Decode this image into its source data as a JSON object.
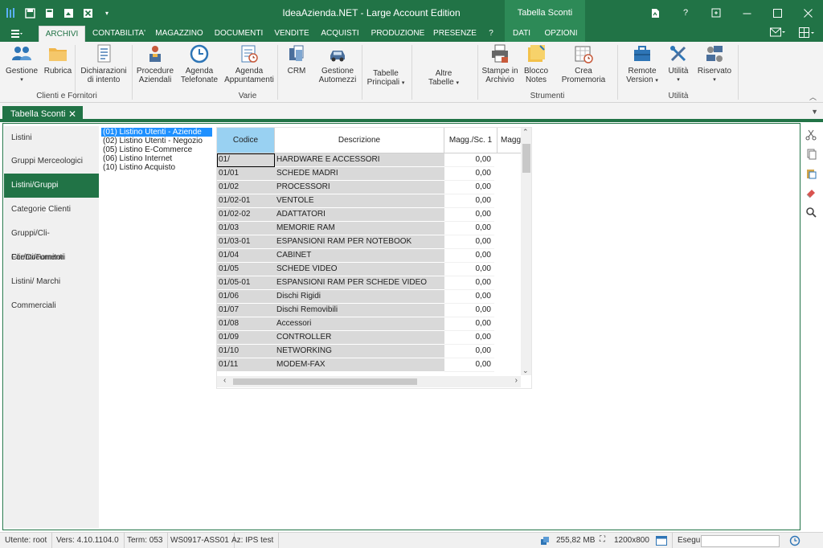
{
  "window": {
    "title": "IdeaAzienda.NET - Large Account Edition",
    "context_tab_title": "Tabella Sconti",
    "controls": [
      "help",
      "question",
      "restore",
      "minimize",
      "maximize",
      "close"
    ]
  },
  "ribbon_tabs": [
    {
      "label": "ARCHIVI",
      "active": true
    },
    {
      "label": "CONTABILITA'"
    },
    {
      "label": "MAGAZZINO"
    },
    {
      "label": "DOCUMENTI"
    },
    {
      "label": "VENDITE"
    },
    {
      "label": "ACQUISTI"
    },
    {
      "label": "PRODUZIONE"
    },
    {
      "label": "PRESENZE"
    },
    {
      "label": "?"
    },
    {
      "label": "DATI"
    },
    {
      "label": "OPZIONI"
    }
  ],
  "ribbon": {
    "buttons": [
      {
        "label1": "Gestione",
        "label2": "",
        "dropdown": true,
        "icon": "users-icon"
      },
      {
        "label1": "Rubrica",
        "label2": "",
        "icon": "folder-icon"
      },
      {
        "label1": "Dichiarazioni",
        "label2": "di intento",
        "icon": "document-icon"
      },
      {
        "label1": "Procedure",
        "label2": "Aziendali",
        "icon": "procedure-icon"
      },
      {
        "label1": "Agenda",
        "label2": "Telefonate",
        "icon": "clock-icon"
      },
      {
        "label1": "Agenda",
        "label2": "Appuntamenti",
        "icon": "calendar-icon"
      },
      {
        "label1": "CRM",
        "label2": "",
        "icon": "crm-icon"
      },
      {
        "label1": "Gestione",
        "label2": "Automezzi",
        "icon": "car-icon"
      },
      {
        "label1": "Tabelle",
        "label2": "Principali",
        "dropdown_inline": true
      },
      {
        "label1": "Altre",
        "label2": "Tabelle",
        "dropdown_inline": true
      },
      {
        "label1": "Stampe in",
        "label2": "Archivio",
        "icon": "printer-icon"
      },
      {
        "label1": "Blocco",
        "label2": "Notes",
        "icon": "notes-icon"
      },
      {
        "label1": "Crea Promemoria",
        "label2": "",
        "icon": "reminder-icon"
      },
      {
        "label1": "Remote",
        "label2": "Version",
        "dropdown_inline": true,
        "icon": "briefcase-icon"
      },
      {
        "label1": "Utilità",
        "label2": "",
        "dropdown": true,
        "icon": "tools-icon"
      },
      {
        "label1": "Riservato",
        "label2": "",
        "dropdown": true,
        "icon": "gears-icon"
      }
    ],
    "groups": [
      "Clienti e Fornitori",
      "Varie",
      "Strumenti",
      "Utilità"
    ]
  },
  "document_tab": {
    "label": "Tabella Sconti",
    "close": "✕"
  },
  "left_nav": [
    {
      "label": "Listini"
    },
    {
      "label": "Gruppi Merceologici"
    },
    {
      "label": "Listini/Gruppi Merceologici",
      "active": true
    },
    {
      "label": "Categorie Clienti"
    },
    {
      "label": "Gruppi/Cli-For/Documenti"
    },
    {
      "label": "Clienti/Fornitori"
    },
    {
      "label": "Listini/ Marchi Commerciali"
    }
  ],
  "price_lists": [
    {
      "label": "(01) Listino Utenti - Aziende",
      "selected": true
    },
    {
      "label": "(02) Listino Utenti - Negozio"
    },
    {
      "label": "(05) Listino E-Commerce"
    },
    {
      "label": "(06) Listino Internet"
    },
    {
      "label": "(10) Listino Acquisto"
    }
  ],
  "grid": {
    "headers": [
      "Codice",
      "Descrizione",
      "Magg./Sc. 1",
      "Magg"
    ],
    "rows": [
      {
        "code": "01/",
        "desc": "HARDWARE E ACCESSORI",
        "value": "0,00"
      },
      {
        "code": "01/01",
        "desc": "SCHEDE MADRI",
        "value": "0,00"
      },
      {
        "code": "01/02",
        "desc": "PROCESSORI",
        "value": "0,00"
      },
      {
        "code": "01/02-01",
        "desc": "VENTOLE",
        "value": "0,00"
      },
      {
        "code": "01/02-02",
        "desc": "ADATTATORI",
        "value": "0,00"
      },
      {
        "code": "01/03",
        "desc": "MEMORIE RAM",
        "value": "0,00"
      },
      {
        "code": "01/03-01",
        "desc": "ESPANSIONI RAM PER NOTEBOOK",
        "value": "0,00"
      },
      {
        "code": "01/04",
        "desc": "CABINET",
        "value": "0,00"
      },
      {
        "code": "01/05",
        "desc": "SCHEDE VIDEO",
        "value": "0,00"
      },
      {
        "code": "01/05-01",
        "desc": "ESPANSIONI RAM PER SCHEDE VIDEO",
        "value": "0,00"
      },
      {
        "code": "01/06",
        "desc": "Dischi Rigidi",
        "value": "0,00"
      },
      {
        "code": "01/07",
        "desc": "Dischi Removibili",
        "value": "0,00"
      },
      {
        "code": "01/08",
        "desc": "Accessori",
        "value": "0,00"
      },
      {
        "code": "01/09",
        "desc": "CONTROLLER",
        "value": "0,00"
      },
      {
        "code": "01/10",
        "desc": "NETWORKING",
        "value": "0,00"
      },
      {
        "code": "01/11",
        "desc": "MODEM-FAX",
        "value": "0,00"
      }
    ]
  },
  "right_tools": [
    "scissors-icon",
    "copy-icon",
    "paste-icon",
    "eraser-icon",
    "search-icon"
  ],
  "status": {
    "user": "Utente: root",
    "version": "Vers: 4.10.1104.0",
    "term": "Term: 053",
    "ws": "WS0917-ASS01",
    "az": "Az: IPS test",
    "memory": "255,82 MB",
    "resolution": "1200x800",
    "esegui": "Esegui"
  },
  "colors": {
    "accent": "#217346",
    "header_highlight": "#99d1f2",
    "selection": "#1e90ff"
  }
}
